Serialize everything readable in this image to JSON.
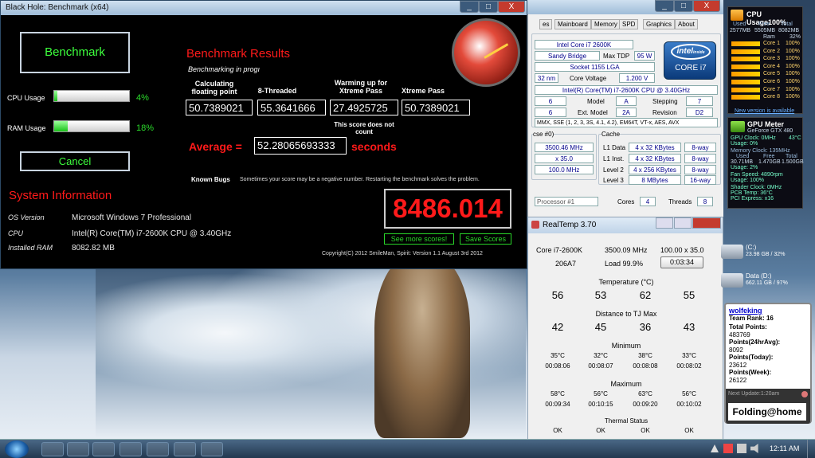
{
  "blackhole": {
    "title": "Black Hole: Benchmark (x64)",
    "min": "_",
    "max": "□",
    "close": "X",
    "benchmark_btn": "Benchmark",
    "cancel_btn": "Cancel",
    "cpu_usage_label": "CPU Usage",
    "cpu_usage": "4%",
    "cpu_pct": 0.04,
    "ram_usage_label": "RAM Usage",
    "ram_usage": "18%",
    "ram_pct": 0.18,
    "results_title": "Benchmark Results",
    "status": "Benchmarking in progı",
    "col1": "Calculating floating point",
    "col2": "8-Threaded",
    "col3": "Warming  up for Xtreme Pass",
    "col4": "Xtreme Pass",
    "v1": "50.7389021",
    "v2": "55.3641666",
    "v3": "27.4925725",
    "v4": "50.7389021",
    "note": "This score does not count",
    "avg_label": "Average =",
    "avg_value": "52.28065693333",
    "avg_unit": "seconds",
    "bugs_label": "Known Bugs",
    "bugs_text": "Sometimes your score may be a negative number. Restarting the benchmark solves the problem.",
    "score": "8486.014",
    "more_scores": "See more scores!",
    "save_scores": "Save Scores",
    "copyright": "Copyright(C) 2012 SmileMan, Spirit: Version 1.1 August 3rd 2012",
    "sys_title": "System Information",
    "os_label": "OS Version",
    "os": "Microsoft Windows 7 Professional",
    "cpu_label": "CPU",
    "cpu": "Intel(R) Core(TM) i7-2600K CPU @ 3.40GHz",
    "ram_label": "Installed RAM",
    "ram": "8082.82 MB"
  },
  "cpuz": {
    "tabs": [
      "es",
      "Mainboard",
      "Memory",
      "SPD",
      "Graphics",
      "About"
    ],
    "name": "Intel Core i7 2600K",
    "codename": "Sandy Bridge",
    "tdp_label": "Max TDP",
    "tdp": "95 W",
    "package": "Socket 1155 LGA",
    "tech": "32 nm",
    "voltage_label": "Core Voltage",
    "voltage": "1.200 V",
    "spec": "Intel(R) Core(TM) i7-2600K CPU @ 3.40GHz",
    "family": "6",
    "model_label": "Model",
    "model": "A",
    "stepping_label": "Stepping",
    "stepping": "7",
    "extfamily": "6",
    "extmodel_label": "Ext. Model",
    "extmodel": "2A",
    "revision_label": "Revision",
    "revision": "D2",
    "instructions": "MMX, SSE (1, 2, 3, 3S, 4.1, 4.2), EM64T, VT-x, AES, AVX",
    "clocks_label": "cse #0)",
    "core_speed": "3500.46 MHz",
    "multiplier": "x 35.0",
    "bus": "100.0 MHz",
    "cache_label": "Cache",
    "l1d_label": "L1 Data",
    "l1d": "4 x 32 KBytes",
    "l1d_way": "8-way",
    "l1i_label": "L1 Inst.",
    "l1i": "4 x 32 KBytes",
    "l1i_way": "8-way",
    "l2_label": "Level 2",
    "l2": "4 x 256 KBytes",
    "l2_way": "8-way",
    "l3_label": "Level 3",
    "l3": "8 MBytes",
    "l3_way": "16-way",
    "processor": "Processor #1",
    "cores_label": "Cores",
    "cores": "4",
    "threads_label": "Threads",
    "threads": "8",
    "intel_logo": "intel",
    "intel_inside": "inside",
    "core_i7": "CORE i7"
  },
  "realtemp": {
    "title": "RealTemp 3.70",
    "cpu": "Core i7-2600K",
    "mhz": "3500.09 MHz",
    "mult": "100.00 x 35.0",
    "cpuid": "206A7",
    "load": "Load  99.9%",
    "timer": "0:03:34",
    "temp_label": "Temperature (°C)",
    "temps": [
      "56",
      "53",
      "62",
      "55"
    ],
    "dist_label": "Distance to TJ Max",
    "dists": [
      "42",
      "45",
      "36",
      "43"
    ],
    "min_label": "Minimum",
    "mins": [
      "35°C",
      "32°C",
      "38°C",
      "33°C"
    ],
    "min_times": [
      "00:08:06",
      "00:08:07",
      "00:08:08",
      "00:08:02"
    ],
    "max_label": "Maximum",
    "maxs": [
      "58°C",
      "56°C",
      "63°C",
      "56°C"
    ],
    "max_times": [
      "00:09:34",
      "00:10:15",
      "00:09:20",
      "00:10:02"
    ],
    "thermal_label": "Thermal Status",
    "status": [
      "OK",
      "OK",
      "OK",
      "OK"
    ]
  },
  "cpu_gadget": {
    "title": "CPU Usage100%",
    "used_label": "Used",
    "free_label": "Free",
    "total_label": "Total",
    "used": "2577MB",
    "free": "5505MB",
    "total": "8082MB",
    "ram_label": "Ram",
    "ram_pct": "32%",
    "cores": [
      {
        "label": "Core 1",
        "pct": "100%"
      },
      {
        "label": "Core 2",
        "pct": "100%"
      },
      {
        "label": "Core 3",
        "pct": "100%"
      },
      {
        "label": "Core 4",
        "pct": "100%"
      },
      {
        "label": "Core 5",
        "pct": "100%"
      },
      {
        "label": "Core 6",
        "pct": "100%"
      },
      {
        "label": "Core 7",
        "pct": "100%"
      },
      {
        "label": "Core 8",
        "pct": "100%"
      }
    ],
    "update": "New version is available"
  },
  "gpu_gadget": {
    "title": "GPU Meter",
    "model": "GeForce GTX 480",
    "clock": "GPU Clock: 0MHz",
    "temp": "43°C",
    "usage": "Usage: 0%",
    "mem_clock": "Memory Clock: 135MHz",
    "used_label": "Used",
    "free_label": "Free",
    "total_label": "Total",
    "mem_used": "30.71MB",
    "mem_free": "1.470GB",
    "mem_total": "1.500GB",
    "mem_usage": "Usage: 2%",
    "fan": "Fan Speed: 4890rpm",
    "fan_usage": "Usage: 100%",
    "shader": "Shader Clock: 0MHz",
    "pcb": "PCB Temp: 36°C",
    "pci": "PCI Express: x16"
  },
  "drives": [
    {
      "label": "(C:)",
      "info": "23.98 GB / 32%"
    },
    {
      "label": "Data  (D:)",
      "info": "662.11 GB / 97%"
    }
  ],
  "folding": {
    "user": "wolfeking",
    "rank": "Team Rank: 16",
    "total_label": "Total Points:",
    "total": "483769",
    "p24_label": "Points(24hrAvg):",
    "p24": "8092",
    "today_label": "Points(Today):",
    "today": "23612",
    "week_label": "Points(Week):",
    "week": "26122",
    "next": "Next Update:1:20am",
    "brand": "Folding@home"
  },
  "taskbar": {
    "time": "12:11 AM"
  }
}
